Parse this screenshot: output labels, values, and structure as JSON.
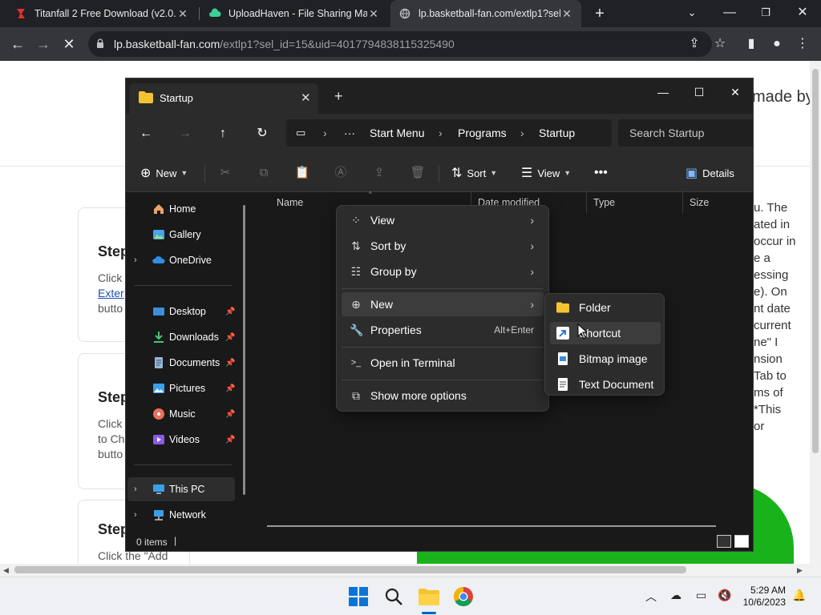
{
  "browser": {
    "tabs": [
      {
        "label": "Titanfall 2 Free Download (v2.0.7",
        "close": "✕"
      },
      {
        "label": "UploadHaven - File Sharing Mad",
        "close": "✕"
      },
      {
        "label": "lp.basketball-fan.com/extlp1?sel_",
        "close": "✕"
      }
    ],
    "url_host": "lp.basketball-fan.com",
    "url_path": "/extlp1?sel_id=15&uid=4017794838115325490"
  },
  "webpage": {
    "made_by": "made by",
    "cards": [
      {
        "title": "Step",
        "line1": "Click",
        "link": "Exter",
        "line3": "butto"
      },
      {
        "title": "Step",
        "line1": "Click",
        "line2": "to Ch",
        "line3": "butto"
      },
      {
        "title": "Step",
        "line1": "Click the \"Add"
      }
    ],
    "right_text": [
      "u. The",
      "ated in",
      "occur in",
      "e a",
      "essing",
      "e). On",
      "nt date",
      "current",
      "ne\" I",
      "nsion",
      " Tab to",
      "ms of",
      "*This",
      "or"
    ]
  },
  "explorer": {
    "tab_title": "Startup",
    "breadcrumbs": [
      "Start Menu",
      "Programs",
      "Startup"
    ],
    "search_placeholder": "Search Startup",
    "commands": {
      "new": "New",
      "sort": "Sort",
      "view": "View",
      "details": "Details"
    },
    "nav": {
      "home": "Home",
      "gallery": "Gallery",
      "onedrive": "OneDrive",
      "desktop": "Desktop",
      "downloads": "Downloads",
      "documents": "Documents",
      "pictures": "Pictures",
      "music": "Music",
      "videos": "Videos",
      "thispc": "This PC",
      "network": "Network"
    },
    "columns": [
      "Name",
      "Date modified",
      "Type",
      "Size"
    ],
    "status": "0 items"
  },
  "context_menu": {
    "items": [
      {
        "label": "View"
      },
      {
        "label": "Sort by"
      },
      {
        "label": "Group by"
      },
      {
        "label": "New"
      },
      {
        "label": "Properties",
        "shortcut": "Alt+Enter"
      },
      {
        "label": "Open in Terminal"
      },
      {
        "label": "Show more options"
      }
    ],
    "submenu": [
      "Folder",
      "Shortcut",
      "Bitmap image",
      "Text Document"
    ]
  },
  "taskbar": {
    "time": "5:29 AM",
    "date": "10/6/2023"
  },
  "colors": {
    "accent": "#0067c0",
    "folder": "#f4c430",
    "green": "#1ab21a"
  }
}
